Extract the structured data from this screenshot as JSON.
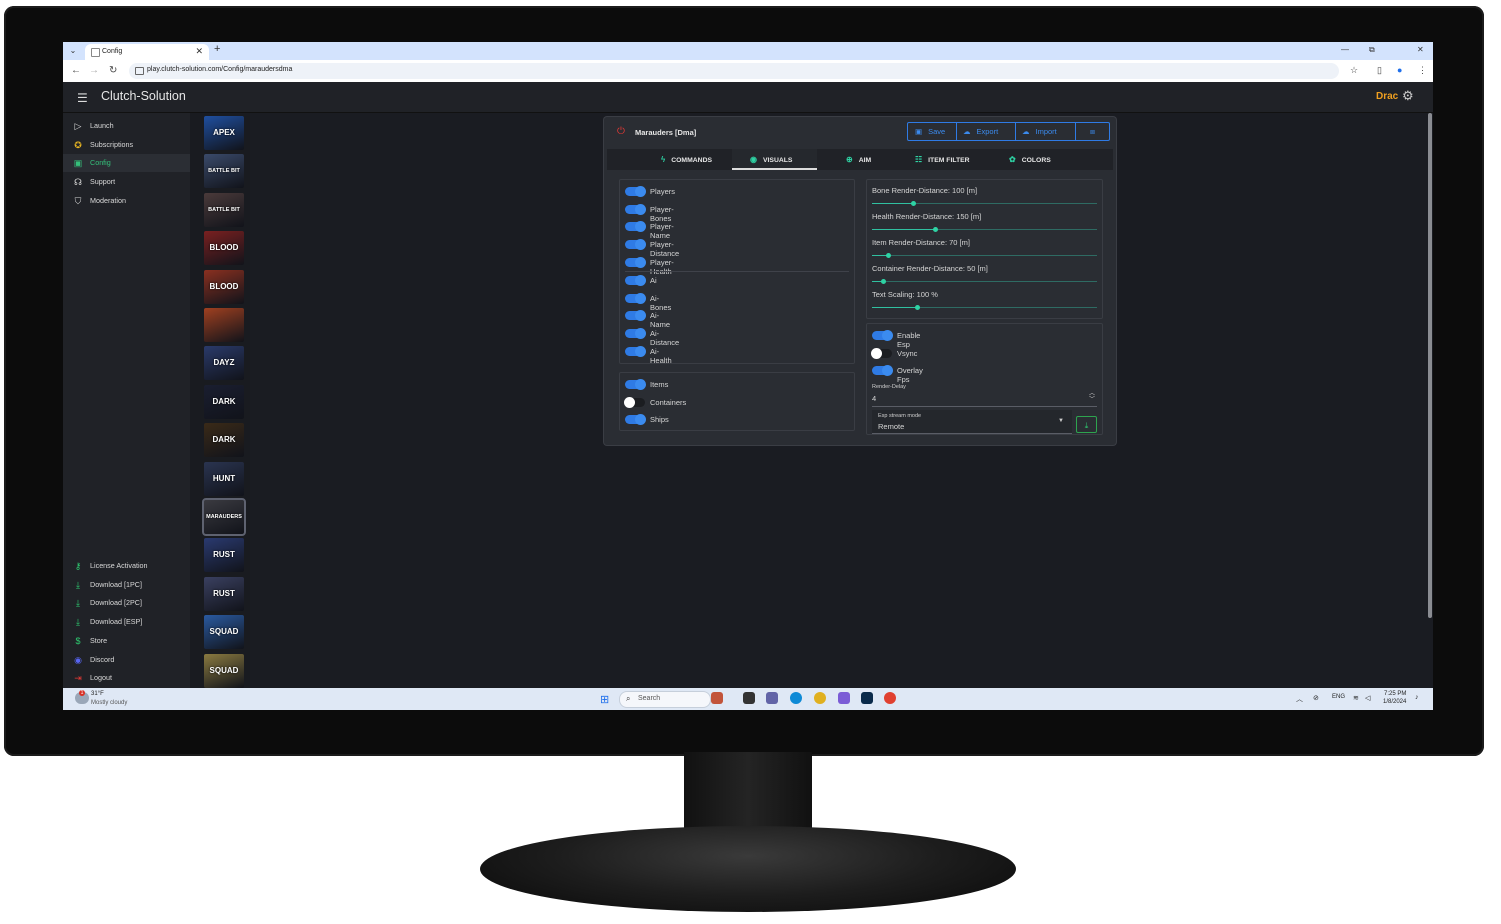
{
  "browser": {
    "tab_title": "Config",
    "tab_close": "✕",
    "new_tab": "+",
    "url": "play.clutch-solution.com/Config/maraudersdma"
  },
  "app": {
    "title": "Clutch-Solution",
    "user": "Drac"
  },
  "sidebar": {
    "top": [
      {
        "label": "Launch",
        "icon": "▷",
        "color": "#d9d9d9"
      },
      {
        "label": "Subscriptions",
        "icon": "✪",
        "color": "#e6b422"
      },
      {
        "label": "Config",
        "icon": "▣",
        "color": "#d9d9d9",
        "active": true
      },
      {
        "label": "Support",
        "icon": "☊",
        "color": "#d9d9d9"
      },
      {
        "label": "Moderation",
        "icon": "⛉",
        "color": "#d9d9d9"
      }
    ],
    "bottom": [
      {
        "label": "License Activation",
        "icon": "⚷",
        "color": "#2ecc71"
      },
      {
        "label": "Download [1PC]",
        "icon": "⤓",
        "color": "#2ecc71"
      },
      {
        "label": "Download [2PC]",
        "icon": "⤓",
        "color": "#2ecc71"
      },
      {
        "label": "Download [ESP]",
        "icon": "⤓",
        "color": "#2ecc71"
      },
      {
        "label": "Store",
        "icon": "$",
        "color": "#2ecc71"
      },
      {
        "label": "Discord",
        "icon": "◉",
        "color": "#5865f2"
      },
      {
        "label": "Logout",
        "icon": "⇥",
        "color": "#e53935"
      }
    ]
  },
  "games": [
    {
      "label": "APEX",
      "bg": "#1f4fa0"
    },
    {
      "label": "BATTLE BIT",
      "bg": "#3a4a6a"
    },
    {
      "label": "BATTLE BIT",
      "bg": "#4a3a3a"
    },
    {
      "label": "BLOOD",
      "bg": "#7a2020"
    },
    {
      "label": "BLOOD",
      "bg": "#8a3020"
    },
    {
      "label": "",
      "bg": "#a04020"
    },
    {
      "label": "DAYZ",
      "bg": "#2a3a6a"
    },
    {
      "label": "DARK",
      "bg": "#1a1e30"
    },
    {
      "label": "DARK",
      "bg": "#3a2a18"
    },
    {
      "label": "HUNT",
      "bg": "#2a3450"
    },
    {
      "label": "MARAUDERS",
      "bg": "#3a3a40",
      "selected": true
    },
    {
      "label": "RUST",
      "bg": "#2a3a70"
    },
    {
      "label": "RUST",
      "bg": "#3a4060"
    },
    {
      "label": "SQUAD",
      "bg": "#2a5aa0"
    },
    {
      "label": "SQUAD",
      "bg": "#8a7a40"
    }
  ],
  "panel": {
    "title": "Marauders [Dma]",
    "actions": {
      "save": "Save",
      "export": "Export",
      "import": "Import"
    },
    "tabs": [
      "COMMANDS",
      "VISUALS",
      "AIM",
      "ITEM FILTER",
      "COLORS"
    ],
    "active_tab": "VISUALS",
    "players": [
      {
        "label": "Players",
        "on": true
      },
      {
        "label": "Player-Bones",
        "on": true
      },
      {
        "label": "Player-Name",
        "on": true
      },
      {
        "label": "Player-Distance",
        "on": true
      },
      {
        "label": "Player-Health",
        "on": true
      }
    ],
    "ai": [
      {
        "label": "Ai",
        "on": true
      },
      {
        "label": "Ai-Bones",
        "on": true
      },
      {
        "label": "Ai-Name",
        "on": true
      },
      {
        "label": "Ai-Distance",
        "on": true
      },
      {
        "label": "Ai-Health",
        "on": true
      }
    ],
    "items": [
      {
        "label": "Items",
        "on": true
      },
      {
        "label": "Containers",
        "on": false
      },
      {
        "label": "Ships",
        "on": true
      }
    ],
    "sliders": [
      {
        "label": "Bone Render-Distance: 100 [m]",
        "fraction": 0.18
      },
      {
        "label": "Health Render-Distance: 150 [m]",
        "fraction": 0.28
      },
      {
        "label": "Item Render-Distance: 70 [m]",
        "fraction": 0.07
      },
      {
        "label": "Container Render-Distance: 50 [m]",
        "fraction": 0.05
      },
      {
        "label": "Text Scaling: 100 %",
        "fraction": 0.2
      }
    ],
    "esp": [
      {
        "label": "Enable Esp",
        "on": true
      },
      {
        "label": "Vsync",
        "on": false
      },
      {
        "label": "Overlay Fps",
        "on": true
      }
    ],
    "render_delay": {
      "label": "Render-Delay",
      "value": "4"
    },
    "stream_mode": {
      "label": "Esp stream mode",
      "value": "Remote"
    }
  },
  "taskbar": {
    "temp": "31°F",
    "weather": "Mostly cloudy",
    "weather_badge": "1",
    "search": "Search",
    "lang": "ENG",
    "time": "7:25 PM",
    "date": "1/8/2024"
  }
}
